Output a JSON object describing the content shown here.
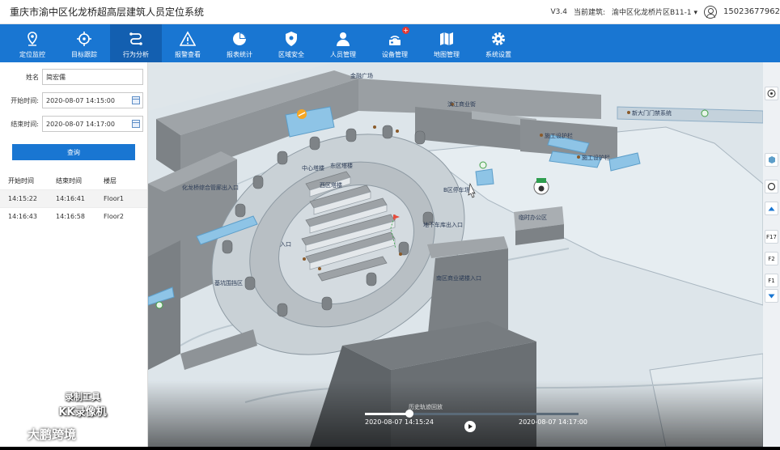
{
  "header": {
    "title": "重庆市渝中区化龙桥超高层建筑人员定位系统",
    "version": "V3.4",
    "building_label": "当前建筑:",
    "building_value": "渝中区化龙桥片区B11-1 ▾",
    "user_phone": "15023677962"
  },
  "nav": {
    "items": [
      {
        "label": "定位监控",
        "icon": "location-pin-icon"
      },
      {
        "label": "目标跟踪",
        "icon": "crosshair-icon"
      },
      {
        "label": "行为分析",
        "icon": "route-icon"
      },
      {
        "label": "报警查看",
        "icon": "warning-icon"
      },
      {
        "label": "报表统计",
        "icon": "pie-chart-icon"
      },
      {
        "label": "区域安全",
        "icon": "shield-icon"
      },
      {
        "label": "人员管理",
        "icon": "person-icon"
      },
      {
        "label": "设备管理",
        "icon": "device-icon"
      },
      {
        "label": "地图管理",
        "icon": "map-icon"
      },
      {
        "label": "系统设置",
        "icon": "gear-icon"
      }
    ],
    "active_index": 2,
    "device_badge": "+"
  },
  "sidebar": {
    "name_label": "姓名",
    "name_value": "简宏儒",
    "start_label": "开始时间:",
    "start_value": "2020-08-07 14:15:00",
    "end_label": "结束时间:",
    "end_value": "2020-08-07 14:17:00",
    "query_button": "查询",
    "table": {
      "headers": [
        "开始时间",
        "结束时间",
        "楼层"
      ],
      "rows": [
        [
          "14:15:22",
          "14:16:41",
          "Floor1"
        ],
        [
          "14:16:43",
          "14:16:58",
          "Floor2"
        ]
      ]
    }
  },
  "map": {
    "labels": {
      "l1": "金融广场",
      "l2": "滨江商业街",
      "l3": "新大门门禁系统",
      "l4": "施工设护栏",
      "l5": "施工设护栏",
      "l6": "化龙桥综合管廊出入口",
      "l7": "东区塔楼",
      "l8": "西区塔楼",
      "l9": "中心塔楼",
      "l10": "入口",
      "l11": "地下车库出入口",
      "l12": "B区停车场",
      "l13": "临时办公区",
      "l14": "基坑围挡区",
      "l15": "南区商业裙楼入口"
    }
  },
  "rightbar": {
    "floor_f17": "F17",
    "floor_f2": "F2",
    "floor_f1": "F1"
  },
  "playback": {
    "start_time": "2020-08-07 14:15:24",
    "end_time": "2020-08-07 14:17:00",
    "caption": "历史轨迹回放",
    "progress": 0.21
  },
  "watermark": {
    "line1": "录制工具",
    "line2": "KK录像机",
    "brand": "大鹏跨境"
  },
  "colors": {
    "nav_bg": "#1976d2",
    "nav_active": "#135fb0",
    "map_bg": "#dfe6ea"
  }
}
